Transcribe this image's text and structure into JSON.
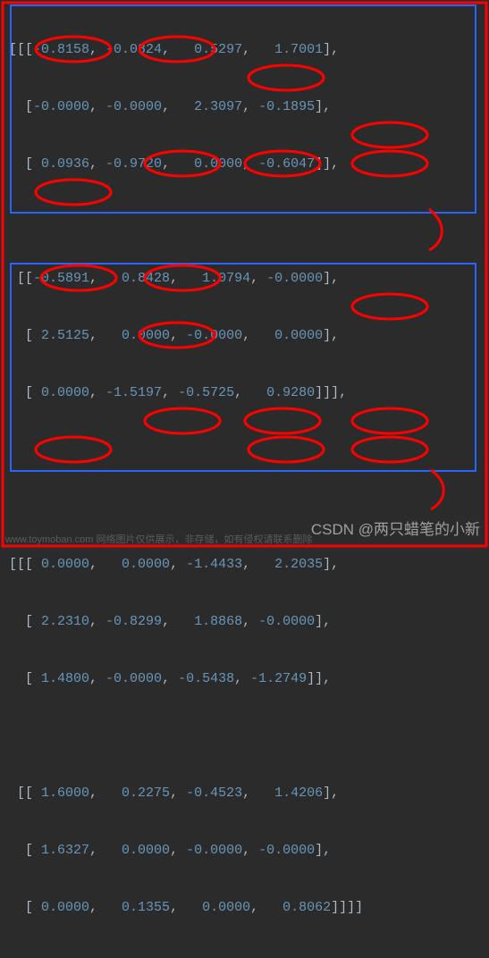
{
  "tensor": {
    "block1": {
      "mat1": [
        [
          "-0.8158",
          "-0.0824",
          " 0.5297",
          " 1.7001"
        ],
        [
          "-0.0000",
          "-0.0000",
          " 2.3097",
          "-0.1895"
        ],
        [
          " 0.0936",
          "-0.9720",
          " 0.0000",
          "-0.6047"
        ]
      ],
      "mat2": [
        [
          "-0.5891",
          " 0.8428",
          " 1.0794",
          "-0.0000"
        ],
        [
          " 2.5125",
          " 0.0000",
          "-0.0000",
          " 0.0000"
        ],
        [
          " 0.0000",
          "-1.5197",
          "-0.5725",
          " 0.9280"
        ]
      ]
    },
    "block2": {
      "mat1": [
        [
          " 0.0000",
          " 0.0000",
          "-1.4433",
          " 2.2035"
        ],
        [
          " 2.2310",
          "-0.8299",
          " 1.8868",
          "-0.0000"
        ],
        [
          " 1.4800",
          "-0.0000",
          "-0.5438",
          "-1.2749"
        ]
      ],
      "mat2": [
        [
          " 1.6000",
          " 0.2275",
          "-0.4523",
          " 1.4206"
        ],
        [
          " 1.6327",
          " 0.0000",
          "-0.0000",
          "-0.0000"
        ],
        [
          " 0.0000",
          " 0.1355",
          " 0.0000",
          " 0.8062"
        ]
      ]
    }
  },
  "highlighted_zero_positions": {
    "block1_mat1": [
      [
        1,
        0
      ],
      [
        1,
        1
      ],
      [
        2,
        2
      ]
    ],
    "block1_mat2": [
      [
        0,
        3
      ],
      [
        1,
        1
      ],
      [
        1,
        2
      ],
      [
        1,
        3
      ],
      [
        2,
        0
      ]
    ],
    "block2_mat1": [
      [
        0,
        0
      ],
      [
        0,
        1
      ],
      [
        1,
        3
      ],
      [
        2,
        1
      ]
    ],
    "block2_mat2": [
      [
        1,
        1
      ],
      [
        1,
        2
      ],
      [
        1,
        3
      ],
      [
        2,
        0
      ],
      [
        2,
        2
      ],
      [
        2,
        3
      ]
    ]
  },
  "watermark_bottom": "www.toymoban.com 网络图片仅供展示，非存储，如有侵权请联系删除",
  "watermark_right": "CSDN @两只蜡笔的小新",
  "annotation": {
    "red_border": true,
    "blue_boxes": 2,
    "red_circles_on_zeros": true
  }
}
